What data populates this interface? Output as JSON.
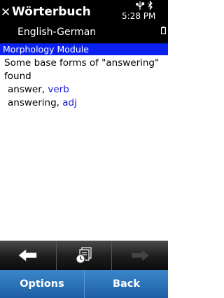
{
  "app": {
    "title": "Wörterbuch",
    "subtitle": "English-German",
    "close_icon": "close-icon"
  },
  "status": {
    "time": "5:28 PM",
    "icons": [
      "usb-icon",
      "bluetooth-icon",
      "battery-icon"
    ]
  },
  "section": {
    "title": "Morphology Module"
  },
  "result": {
    "description": "Some base forms of \"answering\" found",
    "forms": [
      {
        "word": "answer,",
        "pos": "verb"
      },
      {
        "word": "answering,",
        "pos": "adj"
      }
    ]
  },
  "toolbar": {
    "back_icon": "arrow-left-icon",
    "history_icon": "history-icon",
    "forward_icon": "arrow-right-icon",
    "forward_enabled": false
  },
  "softkeys": {
    "left": "Options",
    "right": "Back"
  },
  "colors": {
    "section_header": "#0a20f0",
    "pos_text": "#1a1ad0",
    "softkey_bar": "#2a73b8"
  }
}
